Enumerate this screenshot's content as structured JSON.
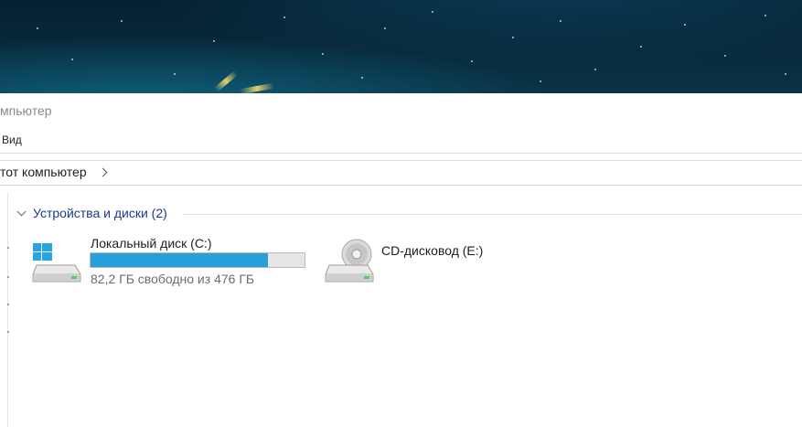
{
  "window": {
    "title_partial": "мпьютер"
  },
  "ribbon": {
    "view_tab": "Вид"
  },
  "address_bar": {
    "location": "тот компьютер"
  },
  "devices_group": {
    "label": "Устройства и диски (2)"
  },
  "drives": [
    {
      "name": "Локальный диск (C:)",
      "free_text": "82,2 ГБ свободно из 476 ГБ",
      "used_fraction": 0.827,
      "bar_color": "#26a0da",
      "icon": "hdd-windows-icon"
    },
    {
      "name": "CD-дисковод (E:)",
      "icon": "cd-drive-icon"
    }
  ]
}
